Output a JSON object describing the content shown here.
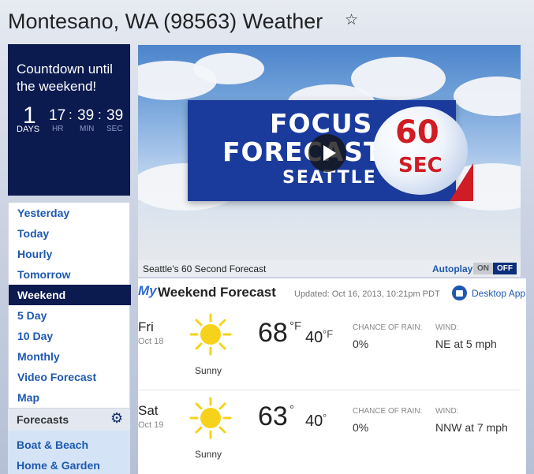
{
  "page": {
    "title": "Montesano, WA (98563) Weather"
  },
  "countdown": {
    "title": "Countdown until the weekend!",
    "days": "1",
    "days_label": "DAYS",
    "hours": "17",
    "hours_label": "HR",
    "minutes": "39",
    "minutes_label": "MIN",
    "seconds": "39",
    "seconds_label": "SEC",
    "separator": ":"
  },
  "nav": {
    "items": [
      {
        "label": "Yesterday"
      },
      {
        "label": "Today"
      },
      {
        "label": "Hourly"
      },
      {
        "label": "Tomorrow"
      },
      {
        "label": "Weekend",
        "active": true
      },
      {
        "label": "5 Day"
      },
      {
        "label": "10 Day"
      },
      {
        "label": "Monthly"
      },
      {
        "label": "Video Forecast"
      },
      {
        "label": "Map"
      }
    ]
  },
  "forecasts": {
    "heading": "Forecasts",
    "items": [
      {
        "label": "Boat & Beach"
      },
      {
        "label": "Home & Garden"
      }
    ]
  },
  "video": {
    "headline_1": "FOCUS",
    "headline_2": "FORECAST",
    "headline_3": "SEATTLE",
    "badge_number": "60",
    "badge_unit": "SEC",
    "caption": "Seattle's 60 Second Forecast",
    "autoplay_label": "Autoplay",
    "toggle_on": "ON",
    "toggle_off": "OFF"
  },
  "weekend": {
    "logo": "My",
    "title": "Weekend Forecast",
    "updated": "Updated: Oct 16, 2013, 10:21pm PDT",
    "desktop_app": "Desktop App",
    "days": [
      {
        "day": "Fri",
        "date": "Oct 18",
        "icon": "sun-icon",
        "condition": "Sunny",
        "high": "68",
        "high_unit": "°F",
        "low": "40",
        "low_unit": "°F",
        "rain_label": "CHANCE OF RAIN:",
        "rain": "0%",
        "wind_label": "WIND:",
        "wind": "NE at 5 mph"
      },
      {
        "day": "Sat",
        "date": "Oct 19",
        "icon": "sun-icon",
        "condition": "Sunny",
        "high": "63",
        "high_unit": "°",
        "low": "40",
        "low_unit": "°",
        "rain_label": "CHANCE OF RAIN:",
        "rain": "0%",
        "wind_label": "WIND:",
        "wind": "NNW at 7 mph"
      }
    ]
  },
  "colors": {
    "navy": "#0b1a4f",
    "link": "#1e58b0",
    "sun": "#f6d21a"
  }
}
